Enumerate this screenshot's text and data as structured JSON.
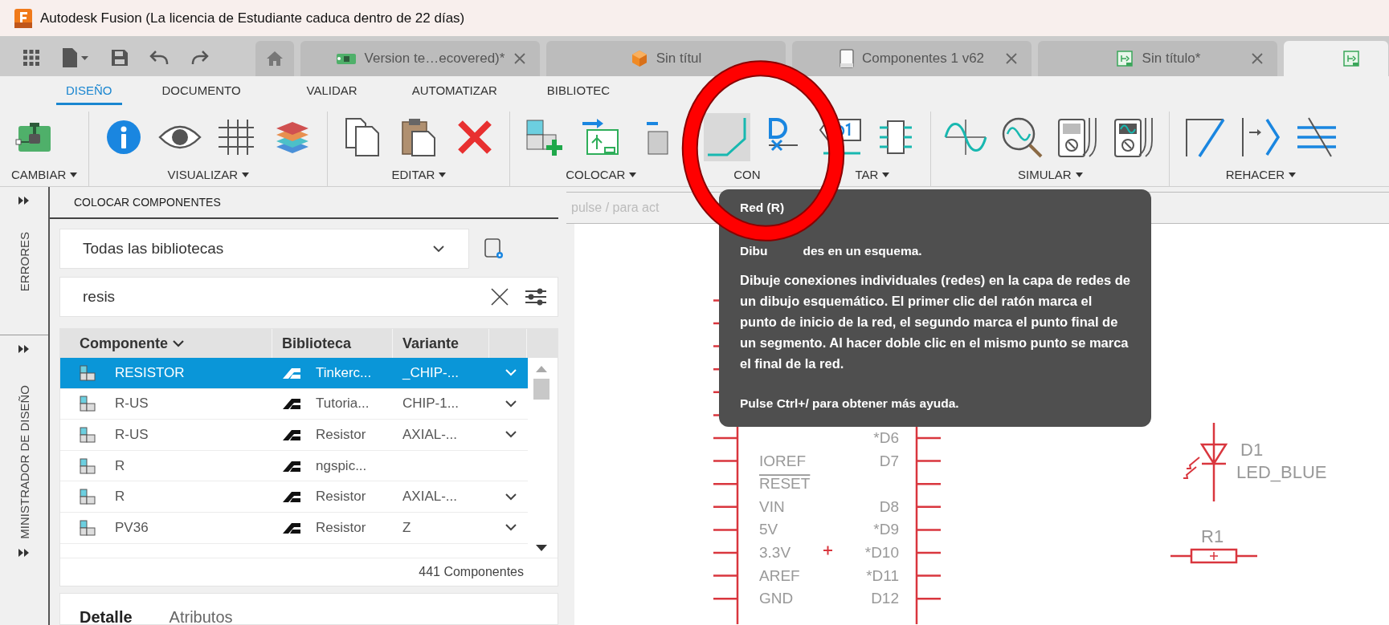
{
  "window": {
    "title": "Autodesk Fusion (La licencia de Estudiante caduca dentro de 22 días)"
  },
  "doc_tabs": [
    {
      "kind": "pcb",
      "label": "Version te…ecovered)*",
      "selected": false,
      "closable": true
    },
    {
      "kind": "cube",
      "label": "Sin títul",
      "selected": false,
      "closable": false
    },
    {
      "kind": "page",
      "label": "Componentes 1 v62",
      "selected": false,
      "closable": true
    },
    {
      "kind": "schematic",
      "label": "Sin título*",
      "selected": false,
      "closable": true
    },
    {
      "kind": "schematic",
      "selected": true,
      "closable": false
    }
  ],
  "ribbon_tabs": [
    {
      "label": "DISEÑO",
      "selected": true
    },
    {
      "label": "DOCUMENTO",
      "selected": false
    },
    {
      "label": "VALIDAR",
      "selected": false
    },
    {
      "label": "AUTOMATIZAR",
      "selected": false
    },
    {
      "label": "BIBLIOTEC",
      "selected": false
    }
  ],
  "tool_groups": [
    {
      "label": "CAMBIAR",
      "tools": [
        {
          "kind": "board",
          "active": false
        }
      ]
    },
    {
      "label": "VISUALIZAR",
      "tools": [
        {
          "kind": "info",
          "active": false
        },
        {
          "kind": "eye",
          "active": false
        },
        {
          "kind": "grid",
          "active": false
        },
        {
          "kind": "layers",
          "active": false
        }
      ]
    },
    {
      "label": "EDITAR",
      "tools": [
        {
          "kind": "copy",
          "active": false
        },
        {
          "kind": "paste",
          "active": false
        },
        {
          "kind": "delete",
          "active": false
        }
      ]
    },
    {
      "label": "COLOCAR",
      "tools": [
        {
          "kind": "add-part",
          "active": false
        },
        {
          "kind": "place-symbol",
          "active": false
        },
        {
          "kind": "box-arrow",
          "active": false
        }
      ]
    },
    {
      "label": "CON",
      "label_after_cover": "TAR",
      "tools": [
        {
          "kind": "net",
          "active": true
        },
        {
          "kind": "name",
          "active": false
        },
        {
          "kind": "label",
          "active": false
        },
        {
          "kind": "chip",
          "active": false
        }
      ]
    },
    {
      "label": "SIMULAR",
      "tools": [
        {
          "kind": "sine",
          "active": false
        },
        {
          "kind": "probe",
          "active": false
        },
        {
          "kind": "meter",
          "active": false
        },
        {
          "kind": "scope-meter",
          "active": false
        }
      ]
    },
    {
      "label": "REHACER",
      "tools": [
        {
          "kind": "route",
          "active": false
        },
        {
          "kind": "arrow",
          "active": false
        },
        {
          "kind": "hatch",
          "active": false
        }
      ]
    }
  ],
  "side_strip": [
    "ERRORES",
    "MINISTRADOR DE DISEÑO"
  ],
  "panel": {
    "title": "COLOCAR COMPONENTES",
    "library": "Todas las bibliotecas",
    "search": "resis",
    "columns": [
      "Componente",
      "Biblioteca",
      "Variante"
    ],
    "rows": [
      {
        "name": "RESISTOR",
        "library": "Tinkerc...",
        "variant": "_CHIP-...",
        "selected": true
      },
      {
        "name": "R-US",
        "library": "Tutoria...",
        "variant": "CHIP-1...",
        "selected": false
      },
      {
        "name": "R-US",
        "library": "Resistor",
        "variant": "AXIAL-...",
        "selected": false
      },
      {
        "name": "R",
        "library": "ngspic...",
        "selected": false
      },
      {
        "name": "R",
        "library": "Resistor",
        "variant": "AXIAL-...",
        "selected": false
      },
      {
        "name": "PV36",
        "library": "Resistor",
        "variant": "Z",
        "selected": false
      }
    ],
    "count": "441 Componentes",
    "detail_tabs": [
      {
        "label": "Detalle",
        "selected": true
      },
      {
        "label": "Atributos",
        "selected": false
      }
    ]
  },
  "canvas": {
    "hint": "pulse / para act",
    "pins": [
      {
        "right": "*D6",
        "overline": false
      },
      {
        "left": "IOREF",
        "right": "D7",
        "overline": false
      },
      {
        "left": "RESET",
        "overline": true
      },
      {
        "left": "VIN",
        "right": "D8",
        "overline": false
      },
      {
        "left": "5V",
        "right": "*D9",
        "overline": false
      },
      {
        "left": "3.3V",
        "right": "*D10",
        "overline": false
      },
      {
        "left": "AREF",
        "right": "*D11",
        "overline": false
      },
      {
        "left": "GND",
        "right": "D12",
        "overline": false
      }
    ],
    "led": {
      "name": "D1",
      "value": "LED_BLUE"
    },
    "resistor": {
      "name": "R1"
    }
  },
  "tooltip": {
    "title": "Red (R)",
    "summary_start": "Dibu",
    "summary_end": "des en un esquema.",
    "body": "Dibuje conexiones individuales (redes) en la capa de redes de un dibujo esquemático. El primer clic del ratón marca el punto de inicio de la red, el segundo marca el punto final de un segmento. Al hacer doble clic en el mismo punto se marca el final de la red.",
    "hint": "Pulse Ctrl+/ para obtener más ayuda."
  }
}
